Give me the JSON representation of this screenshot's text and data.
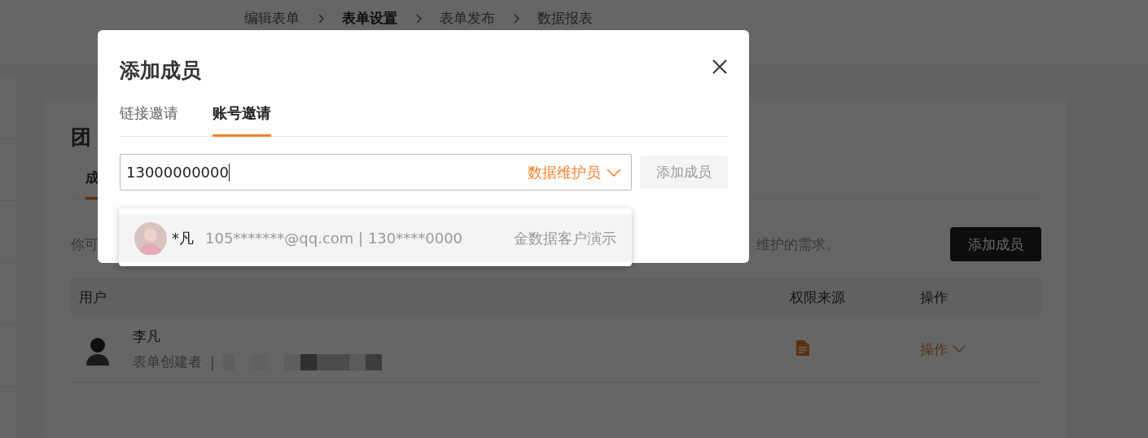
{
  "background_page": {
    "breadcrumb": [
      {
        "label": "编辑表单",
        "selected": false
      },
      {
        "label": "表单设置",
        "selected": true
      },
      {
        "label": "表单发布",
        "selected": false
      },
      {
        "label": "数据报表",
        "selected": false
      }
    ],
    "card_title": "团",
    "tabs": [
      {
        "label": "成",
        "selected": true
      }
    ],
    "description_start": "你可",
    "description_end": "维护的需求。",
    "add_button": "添加成员",
    "table": {
      "columns": [
        "用户",
        "权限来源",
        "操作"
      ],
      "rows": [
        {
          "name": "李凡",
          "role": "表单创建者",
          "separator": "|",
          "action": "操作"
        }
      ]
    }
  },
  "dialog": {
    "title": "添加成员",
    "tabs": [
      {
        "label": "链接邀请",
        "selected": false
      },
      {
        "label": "账号邀请",
        "selected": true
      }
    ],
    "input": {
      "value": "13000000000"
    },
    "role_select": "数据维护员",
    "add_button": {
      "label": "添加成员",
      "disabled": true
    },
    "suggestions": [
      {
        "name": "*凡",
        "contact": "105*******@qq.com | 130****0000",
        "org": "金数据客户演示"
      }
    ]
  }
}
